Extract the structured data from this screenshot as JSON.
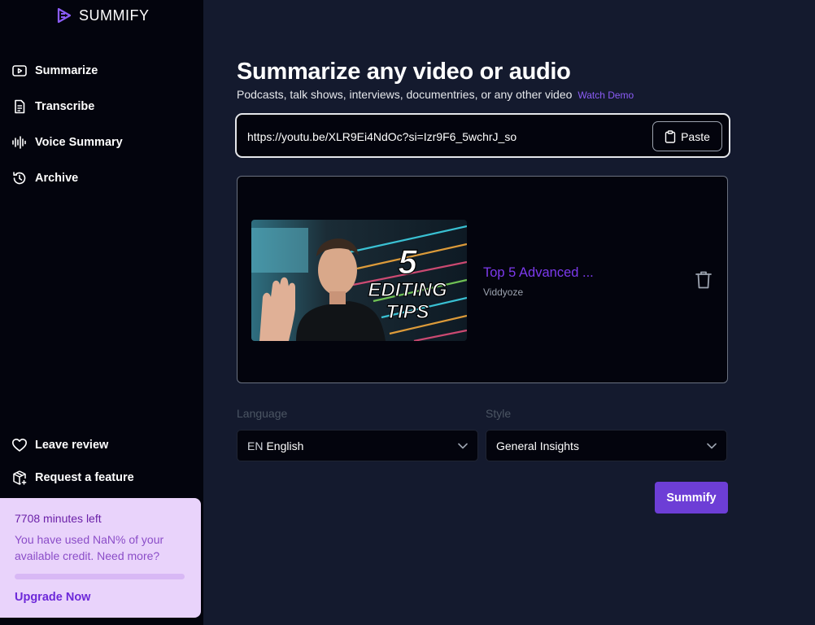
{
  "app": {
    "brand": "SUMMIFY"
  },
  "sidebar": {
    "nav": [
      {
        "label": "Summarize",
        "icon": "play-box-icon"
      },
      {
        "label": "Transcribe",
        "icon": "document-icon"
      },
      {
        "label": "Voice Summary",
        "icon": "waveform-icon"
      },
      {
        "label": "Archive",
        "icon": "history-icon"
      }
    ],
    "footer": [
      {
        "label": "Leave review",
        "icon": "heart-icon"
      },
      {
        "label": "Request a feature",
        "icon": "package-plus-icon"
      }
    ],
    "credits": {
      "title": "7708 minutes left",
      "description": "You have used NaN% of your available credit. Need more?",
      "upgrade_label": "Upgrade Now"
    }
  },
  "main": {
    "title": "Summarize any video or audio",
    "subtitle": "Podcasts, talk shows, interviews, documentries, or any other video",
    "watch_demo": "Watch Demo",
    "url_input": {
      "value": "https://youtu.be/XLR9Ei4NdOc?si=Izr9F6_5wchrJ_so"
    },
    "paste_label": "Paste",
    "video": {
      "title": "Top 5 Advanced ...",
      "channel": "Viddyoze",
      "thumb_big": "5",
      "thumb_line1": "EDITING",
      "thumb_line2": "TIPS"
    },
    "language": {
      "label": "Language",
      "code": "EN",
      "value": "English"
    },
    "style": {
      "label": "Style",
      "value": "General Insights"
    },
    "submit_label": "Summify"
  },
  "colors": {
    "accent": "#6d3ed6",
    "link": "#8b5cf6",
    "sidebar_bg": "#03040d",
    "main_bg": "#141a2e",
    "credit_bg": "#e9d3fb"
  }
}
